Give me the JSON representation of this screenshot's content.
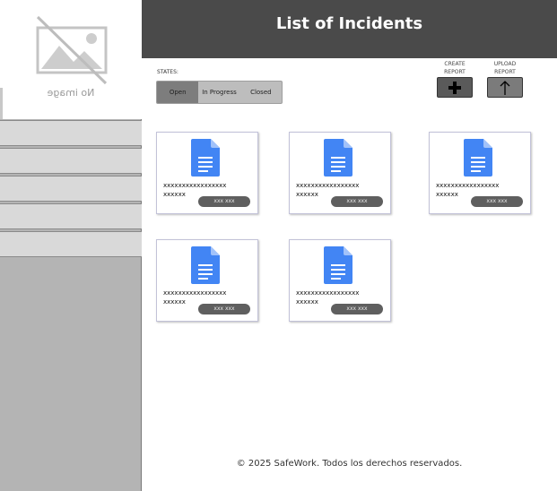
{
  "app": {
    "page_title": "List of Incidents",
    "no_image_caption": "No image"
  },
  "sidebar": {
    "items": [
      {
        "label": ""
      },
      {
        "label": ""
      },
      {
        "label": ""
      },
      {
        "label": ""
      },
      {
        "label": ""
      }
    ]
  },
  "filters": {
    "states_label": "STATES:",
    "options": [
      {
        "label": "Open",
        "selected": true
      },
      {
        "label": "In Progress",
        "selected": false
      },
      {
        "label": "Closed",
        "selected": false
      }
    ]
  },
  "actions": {
    "create": {
      "label_line1": "CREATE",
      "label_line2": "REPORT",
      "icon": "plus-icon"
    },
    "upload": {
      "label_line1": "UPLOAD",
      "label_line2": "REPORT",
      "icon": "upload-arrow-icon"
    }
  },
  "incidents": [
    {
      "title_line1": "xxxxxxxxxxxxxxxxx",
      "title_line2": "xxxxxx",
      "tag": "xxx xxx",
      "icon": "document-icon"
    },
    {
      "title_line1": "xxxxxxxxxxxxxxxxx",
      "title_line2": "xxxxxx",
      "tag": "xxx xxx",
      "icon": "document-icon"
    },
    {
      "title_line1": "xxxxxxxxxxxxxxxxx",
      "title_line2": "xxxxxx",
      "tag": "xxx xxx",
      "icon": "document-icon"
    },
    {
      "title_line1": "xxxxxxxxxxxxxxxxx",
      "title_line2": "xxxxxx",
      "tag": "xxx xxx",
      "icon": "document-icon"
    },
    {
      "title_line1": "xxxxxxxxxxxxxxxxx",
      "title_line2": "xxxxxx",
      "tag": "xxx xxx",
      "icon": "document-icon"
    }
  ],
  "footer": {
    "text": "© 2025 SafeWork. Todos los derechos reservados."
  },
  "colors": {
    "header_bg": "#4a4a4a",
    "sidebar_bg": "#b4b4b4",
    "doc_blue": "#4285f4",
    "active_state": "#7d7d7d"
  }
}
